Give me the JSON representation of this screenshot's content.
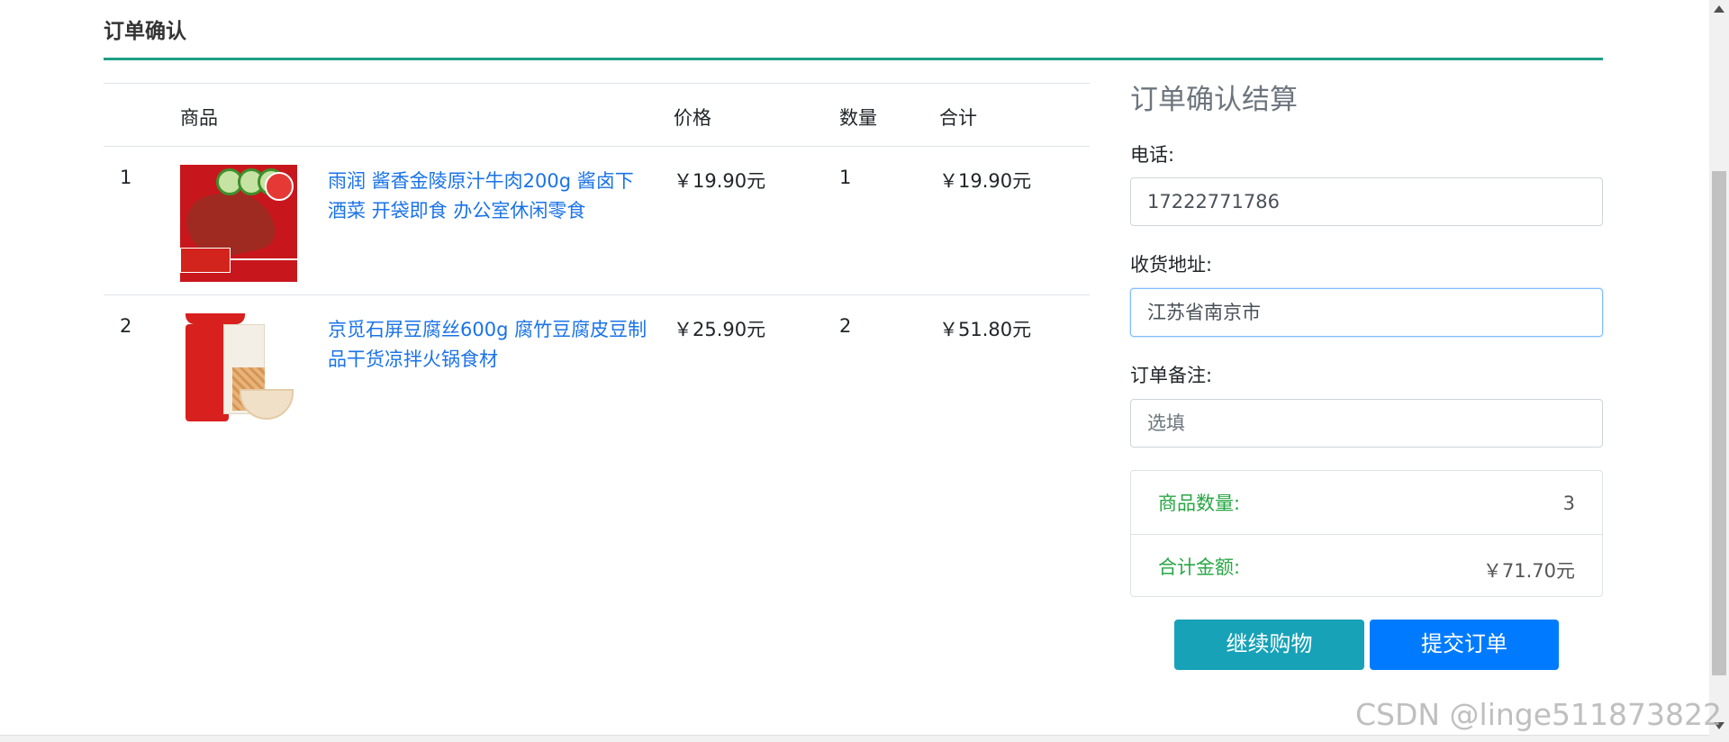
{
  "header": {
    "title": "订单确认"
  },
  "cart": {
    "columns": {
      "product": "商品",
      "price": "价格",
      "quantity": "数量",
      "subtotal": "合计"
    },
    "items": [
      {
        "index": "1",
        "name": "雨润 酱香金陵原汁牛肉200g 酱卤下酒菜 开袋即食 办公室休闲零食",
        "price": "￥19.90元",
        "quantity": "1",
        "subtotal": "￥19.90元",
        "image": "braised-beef-product-image"
      },
      {
        "index": "2",
        "name": "京觅石屏豆腐丝600g 腐竹豆腐皮豆制品干货凉拌火锅食材",
        "price": "￥25.90元",
        "quantity": "2",
        "subtotal": "￥51.80元",
        "image": "tofu-shreds-product-image"
      }
    ]
  },
  "checkout": {
    "title": "订单确认结算",
    "phone_label": "电话:",
    "phone_value": "17222771786",
    "address_label": "收货地址:",
    "address_value": "江苏省南京市",
    "note_label": "订单备注:",
    "note_placeholder": "选填",
    "count_label": "商品数量:",
    "count_value": "3",
    "total_label": "合计金额:",
    "total_value": "￥71.70元",
    "continue_label": "继续购物",
    "submit_label": "提交订单"
  },
  "watermark": "CSDN @linge511873822",
  "colors": {
    "accent_line": "#1e9e86",
    "continue_button": "#17a2b8",
    "submit_button": "#007bff",
    "summary_text": "#28a745",
    "link": "#1a73e8"
  }
}
